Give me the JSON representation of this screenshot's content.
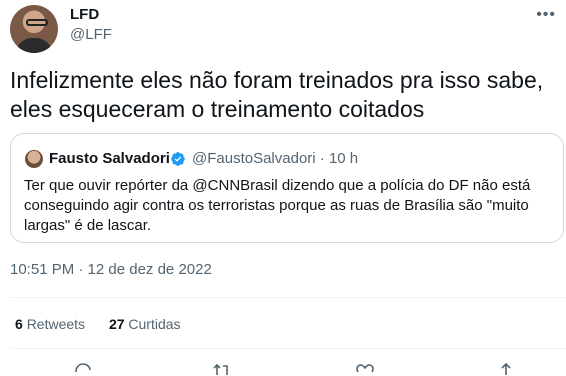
{
  "author": {
    "name": "LFD",
    "handle": "@LFF"
  },
  "tweet": {
    "text_line1": "Infelizmente eles não foram treinados pra isso sabe,",
    "text_line2": "eles esqueceram o treinamento coitados"
  },
  "quoted": {
    "name": "Fausto Salvadori",
    "handle_time": "@FaustoSalvadori · 10 h",
    "text": "Ter que ouvir repórter da @CNNBrasil dizendo que a polícia do DF não está conseguindo agir contra os terroristas porque as ruas de Brasília são \"muito largas\" é de lascar."
  },
  "timestamp": "10:51 PM · 12 de dez de 2022",
  "stats": {
    "retweets_count": "6",
    "retweets_label": "Retweets",
    "likes_count": "27",
    "likes_label": "Curtidas"
  },
  "colors": {
    "secondary_text": "#536471",
    "border": "#cfd9de",
    "verified": "#1d9bf0"
  },
  "icons": [
    "more-icon",
    "verified-icon",
    "reply-icon",
    "retweet-icon",
    "like-icon",
    "share-icon"
  ]
}
